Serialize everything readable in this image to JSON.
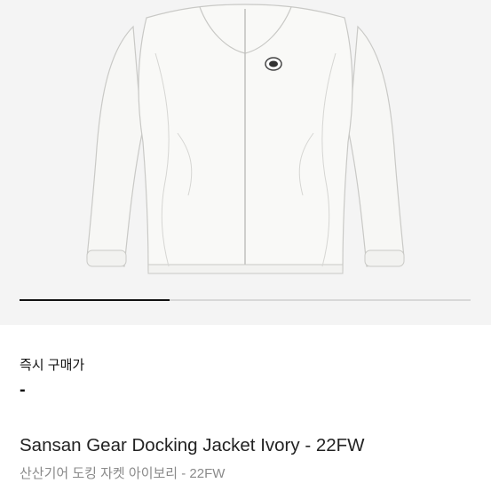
{
  "product": {
    "buy_label": "즉시 구매가",
    "price": "-",
    "title": "Sansan Gear Docking Jacket Ivory - 22FW",
    "subtitle": "산산기어 도킹 자켓 아이보리 - 22FW"
  },
  "gallery": {
    "progress": 0.333
  },
  "colors": {
    "hero_bg": "#f4f4f4",
    "jacket": "#f7f7f5",
    "progress_active": "#111111",
    "progress_track": "#d8d8d8"
  }
}
